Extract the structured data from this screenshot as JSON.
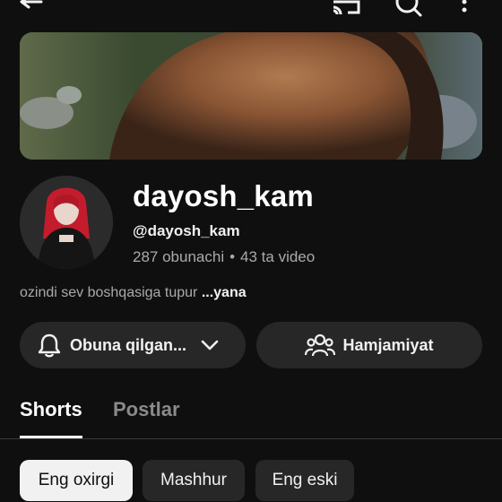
{
  "topbar": {
    "icons": [
      "back-arrow-icon",
      "cast-icon",
      "search-icon",
      "more-vert-icon"
    ]
  },
  "channel": {
    "name": "dayosh_kam",
    "handle": "@dayosh_kam",
    "subscribers": "287 obunachi",
    "separator": "•",
    "videos": "43 ta video",
    "description": "ozindi sev boshqasiga tupur",
    "description_more": "...yana"
  },
  "actions": {
    "subscribe_label": "Obuna qilgan...",
    "community_label": "Hamjamiyat"
  },
  "tabs": [
    {
      "label": "Shorts",
      "selected": true
    },
    {
      "label": "Postlar",
      "selected": false
    }
  ],
  "filters": [
    {
      "label": "Eng oxirgi",
      "selected": true
    },
    {
      "label": "Mashhur",
      "selected": false
    },
    {
      "label": "Eng eski",
      "selected": false
    }
  ],
  "colors": {
    "background": "#0f0f0f",
    "surface": "#272727",
    "text_primary": "#f1f1f1",
    "text_secondary": "#aaaaaa"
  }
}
